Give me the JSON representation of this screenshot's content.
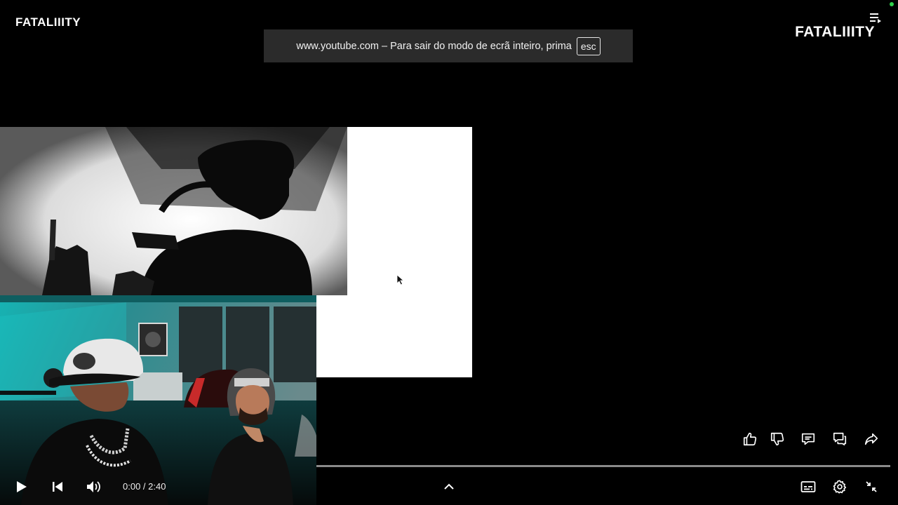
{
  "header": {
    "channel_name_left": "FATALIIITY",
    "channel_name_right": "FATALIIITY",
    "playlist_icon": "playlist-icon"
  },
  "fullscreen_banner": {
    "message": "www.youtube.com – Para sair do modo de ecrã inteiro, prima",
    "key": "esc"
  },
  "player": {
    "current_time": "0:00",
    "separator": " / ",
    "duration": "2:40",
    "progress": 0
  },
  "actions": [
    {
      "name": "like-button",
      "icon": "thumbs-up-icon"
    },
    {
      "name": "dislike-button",
      "icon": "thumbs-down-icon"
    },
    {
      "name": "comments-button",
      "icon": "comment-icon"
    },
    {
      "name": "live-chat-button",
      "icon": "chat-icon"
    },
    {
      "name": "share-button",
      "icon": "share-icon"
    }
  ],
  "controls": {
    "left": [
      "play-icon",
      "previous-icon",
      "volume-icon"
    ],
    "center": [
      "chevron-up-icon"
    ],
    "right": [
      "subtitles-icon",
      "settings-icon",
      "exit-fullscreen-icon"
    ]
  },
  "colors": {
    "background": "#000000",
    "banner": "#2b2b2b",
    "progress_track": "#8a8a8a",
    "status_dot": "#2fd14a",
    "webcam_teal": "#1fa6a6"
  }
}
